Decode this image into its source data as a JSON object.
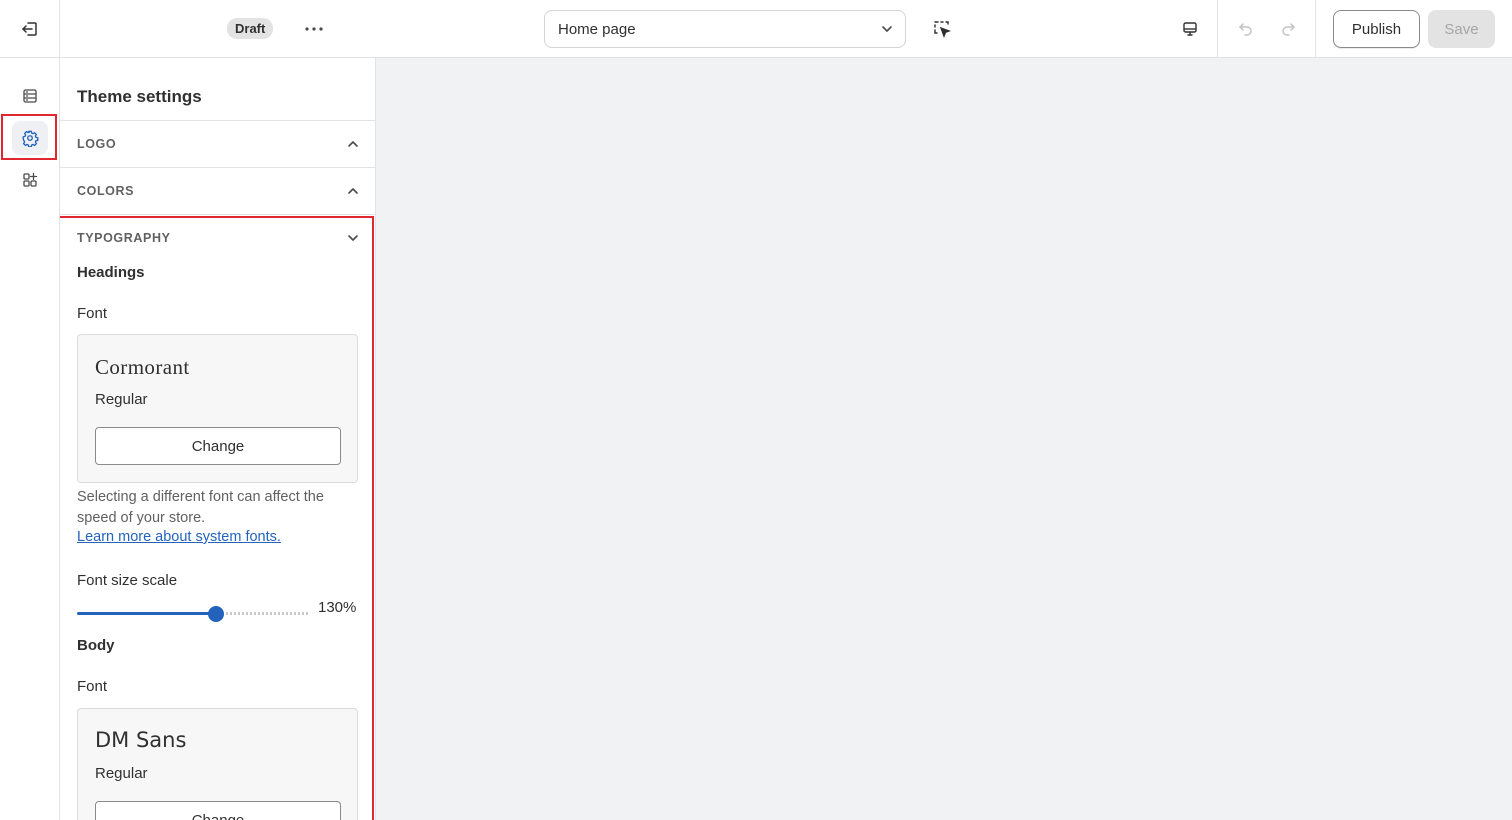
{
  "topbar": {
    "draft_badge": "Draft",
    "page_select": "Home page",
    "publish_label": "Publish",
    "save_label": "Save"
  },
  "rail": {
    "items": [
      {
        "icon": "sections-icon",
        "active": false
      },
      {
        "icon": "gear-icon",
        "active": true
      },
      {
        "icon": "apps-icon",
        "active": false
      }
    ]
  },
  "panel": {
    "title": "Theme settings",
    "sections": {
      "logo": "LOGO",
      "colors": "COLORS",
      "typography": "TYPOGRAPHY"
    },
    "headings": {
      "title": "Headings",
      "font_label": "Font",
      "font_name": "Cormorant",
      "font_style": "Regular",
      "change_label": "Change",
      "help_text": "Selecting a different font can affect the speed of your store.",
      "help_link": "Learn more about system fonts.",
      "size_label": "Font size scale",
      "size_value": "130%",
      "size_percent": 130,
      "size_min": 100,
      "size_max": 150
    },
    "body": {
      "title": "Body",
      "font_label": "Font",
      "font_name": "DM Sans",
      "font_style": "Regular",
      "change_label": "Change"
    }
  },
  "colors": {
    "accent": "#2463bc",
    "highlight": "#e0262f",
    "canvas": "#f1f2f4"
  }
}
